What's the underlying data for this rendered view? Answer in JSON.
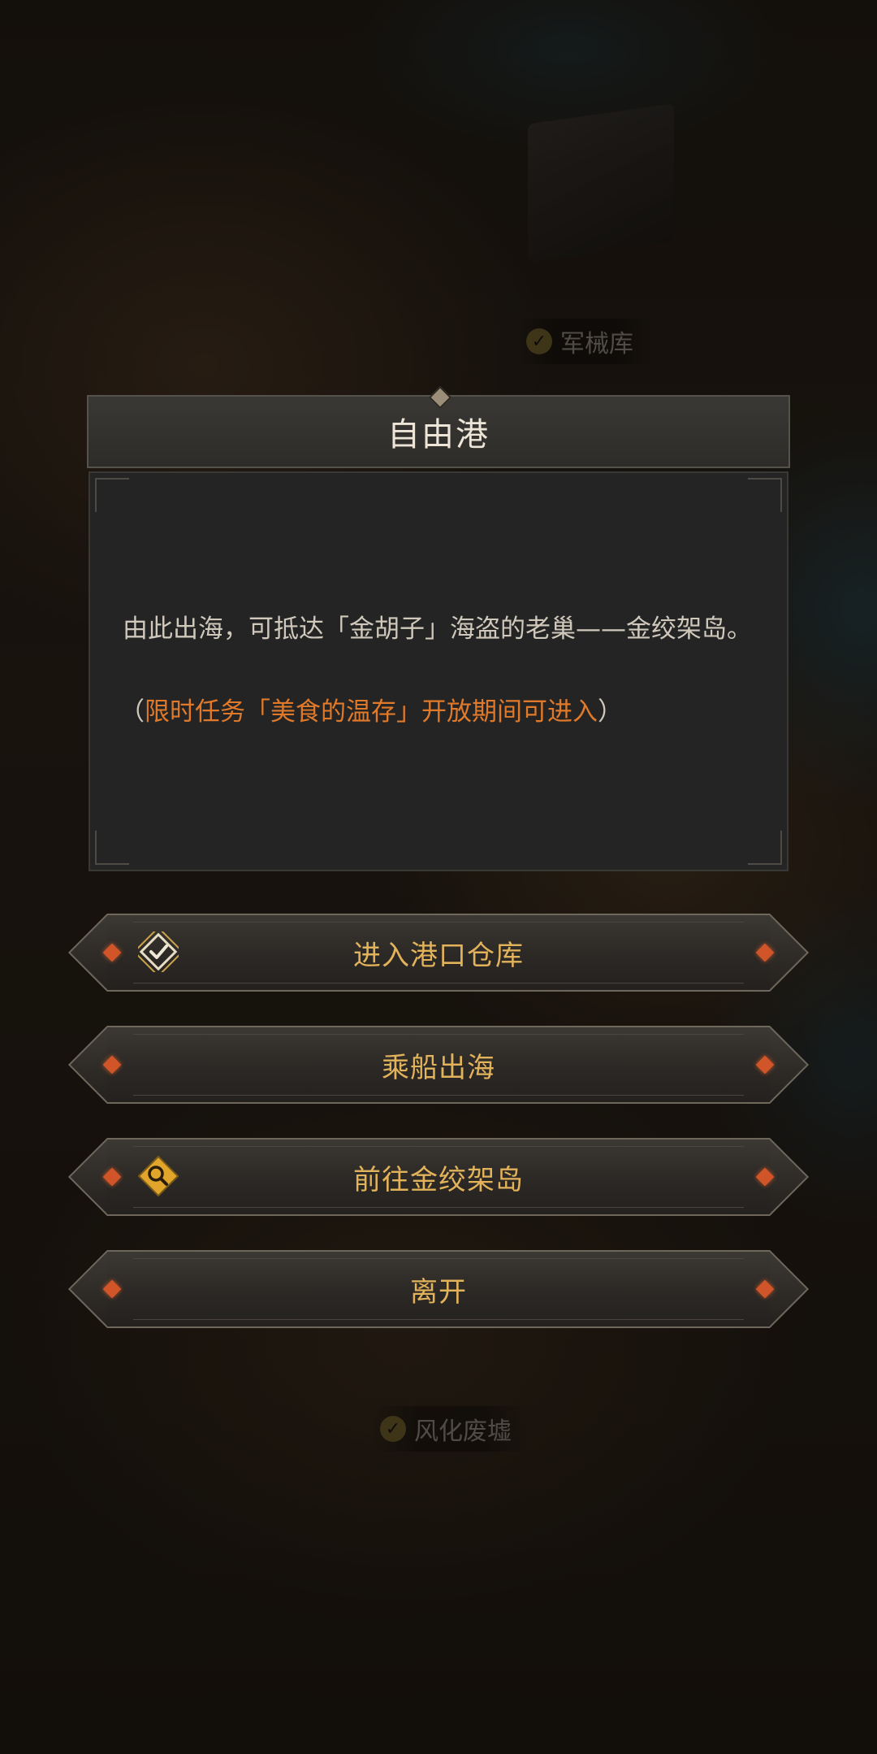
{
  "map": {
    "labels": {
      "arsenal": "军械库",
      "ruins": "风化废墟"
    }
  },
  "dialog": {
    "title": "自由港",
    "description": "由此出海，可抵达「金胡子」海盗的老巢——金绞架岛。",
    "note_open": "（",
    "note_highlight": "限时任务「美食的温存」开放期间可进入",
    "note_close": "）"
  },
  "actions": [
    {
      "label": "进入港口仓库",
      "icon": "quest-check-icon"
    },
    {
      "label": "乘船出海",
      "icon": ""
    },
    {
      "label": "前往金绞架岛",
      "icon": "magnifier-icon"
    },
    {
      "label": "离开",
      "icon": ""
    }
  ],
  "colors": {
    "button_text": "#e2b35a",
    "highlight_text": "#e07a2a",
    "gem": "#d2552a"
  }
}
